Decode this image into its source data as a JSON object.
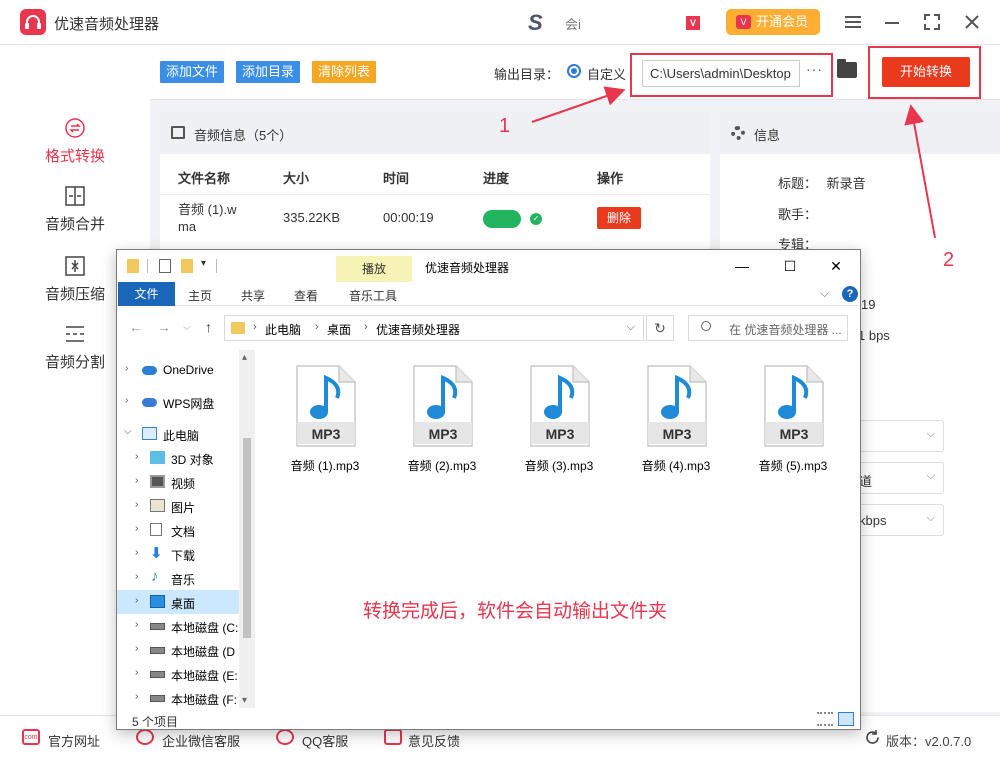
{
  "app": {
    "title": "优速音频处理器",
    "brand_text": "会i",
    "vip_label": "开通会员",
    "vip_badge": "V"
  },
  "sidebar": {
    "items": [
      {
        "label": "格式转换",
        "icon": "format-convert-icon",
        "active": true
      },
      {
        "label": "音频合并",
        "icon": "audio-merge-icon",
        "active": false
      },
      {
        "label": "音频压缩",
        "icon": "audio-compress-icon",
        "active": false
      },
      {
        "label": "音频分割",
        "icon": "audio-split-icon",
        "active": false
      }
    ]
  },
  "toolbar": {
    "add_file": "添加文件",
    "add_dir": "添加目录",
    "clear_list": "清除列表",
    "output_label": "输出目录：",
    "custom_label": "自定义",
    "output_path": "C:\\Users\\admin\\Desktop",
    "more": "···",
    "start": "开始转换"
  },
  "audio_panel": {
    "title": "音频信息（5个）",
    "headers": [
      "文件名称",
      "大小",
      "时间",
      "进度",
      "操作"
    ],
    "rows": [
      {
        "name_line1": "音频 (1).w",
        "name_line2": "ma",
        "size": "335.22KB",
        "time": "00:00:19",
        "progress": 1.0,
        "action": "删除"
      }
    ]
  },
  "info_panel": {
    "title": "信息",
    "title_label": "标题：",
    "title_value": "新录音",
    "singer_label": "歌手：",
    "album_label": "专辑：",
    "frag_duration": "19",
    "frag_bitrate": "1 bps",
    "select1": "",
    "select2": "道",
    "select3": "kbps"
  },
  "annotations": {
    "marker1": "1",
    "marker2": "2"
  },
  "footer": {
    "website": "官方网址",
    "wechat": "企业微信客服",
    "qq": "QQ客服",
    "feedback": "意见反馈",
    "version": "版本：v2.0.7.0",
    "site_icon_text": "com"
  },
  "explorer": {
    "context_tab": "播放",
    "window_title": "优速音频处理器",
    "ribbon_file": "文件",
    "ribbon_tabs": [
      "主页",
      "共享",
      "查看",
      "音乐工具"
    ],
    "breadcrumb": [
      "此电脑",
      "桌面",
      "优速音频处理器"
    ],
    "search_placeholder": "在 优速音频处理器 ...",
    "tree": [
      {
        "label": "OneDrive",
        "level": 0,
        "expand": ">"
      },
      {
        "label": "WPS网盘",
        "level": 0,
        "expand": ">"
      },
      {
        "label": "此电脑",
        "level": 0,
        "expand": "v"
      },
      {
        "label": "3D 对象",
        "level": 1,
        "expand": ">"
      },
      {
        "label": "视频",
        "level": 1,
        "expand": ">"
      },
      {
        "label": "图片",
        "level": 1,
        "expand": ">"
      },
      {
        "label": "文档",
        "level": 1,
        "expand": ">"
      },
      {
        "label": "下载",
        "level": 1,
        "expand": ">"
      },
      {
        "label": "音乐",
        "level": 1,
        "expand": ">"
      },
      {
        "label": "桌面",
        "level": 1,
        "expand": ">",
        "selected": true
      },
      {
        "label": "本地磁盘 (C:",
        "level": 1,
        "expand": ">"
      },
      {
        "label": "本地磁盘 (D",
        "level": 1,
        "expand": ">"
      },
      {
        "label": "本地磁盘 (E:",
        "level": 1,
        "expand": ">"
      },
      {
        "label": "本地磁盘 (F:",
        "level": 1,
        "expand": ">"
      }
    ],
    "files": [
      {
        "name": "音频 (1).mp3"
      },
      {
        "name": "音频 (2).mp3"
      },
      {
        "name": "音频 (3).mp3"
      },
      {
        "name": "音频 (4).mp3"
      },
      {
        "name": "音频 (5).mp3"
      }
    ],
    "file_badge": "MP3",
    "status": "5 个项目",
    "overlay_message": "转换完成后，软件会自动输出文件夹"
  },
  "colors": {
    "accent_red": "#e8364e",
    "blue_btn": "#3a8ee6",
    "orange_btn": "#f5a623",
    "start_btn": "#ea3a1e",
    "progress": "#22b45f",
    "ribbon_blue": "#1a66b8"
  }
}
